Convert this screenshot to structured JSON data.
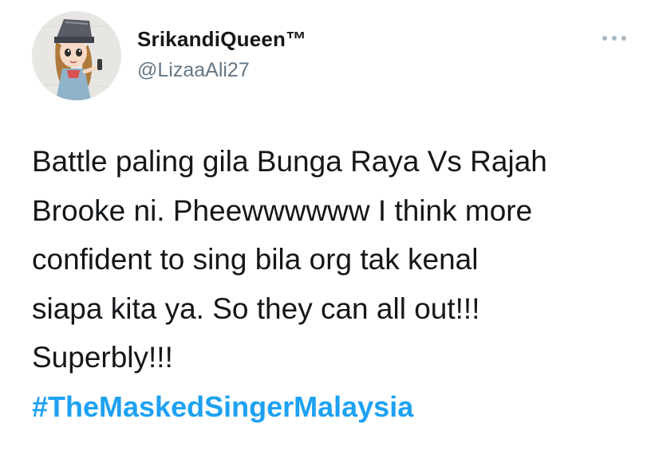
{
  "tweet": {
    "author": {
      "display_name": "SrikandiQueen™",
      "handle": "@LizaaAli27",
      "avatar_icon": "drawn-girl-avatar"
    },
    "menu_icon": "more-dots-icon",
    "body_lines": [
      "Battle paling gila Bunga Raya Vs Rajah",
      "Brooke ni. Pheewwwwww I think more",
      "confident to sing bila org tak kenal",
      "siapa kita ya. So they can all out!!!",
      "Superbly!!!"
    ],
    "hashtag": "#TheMaskedSingerMalaysia"
  },
  "colors": {
    "text": "#14171a",
    "secondary": "#657786",
    "link": "#1da1f2",
    "background": "#ffffff"
  }
}
